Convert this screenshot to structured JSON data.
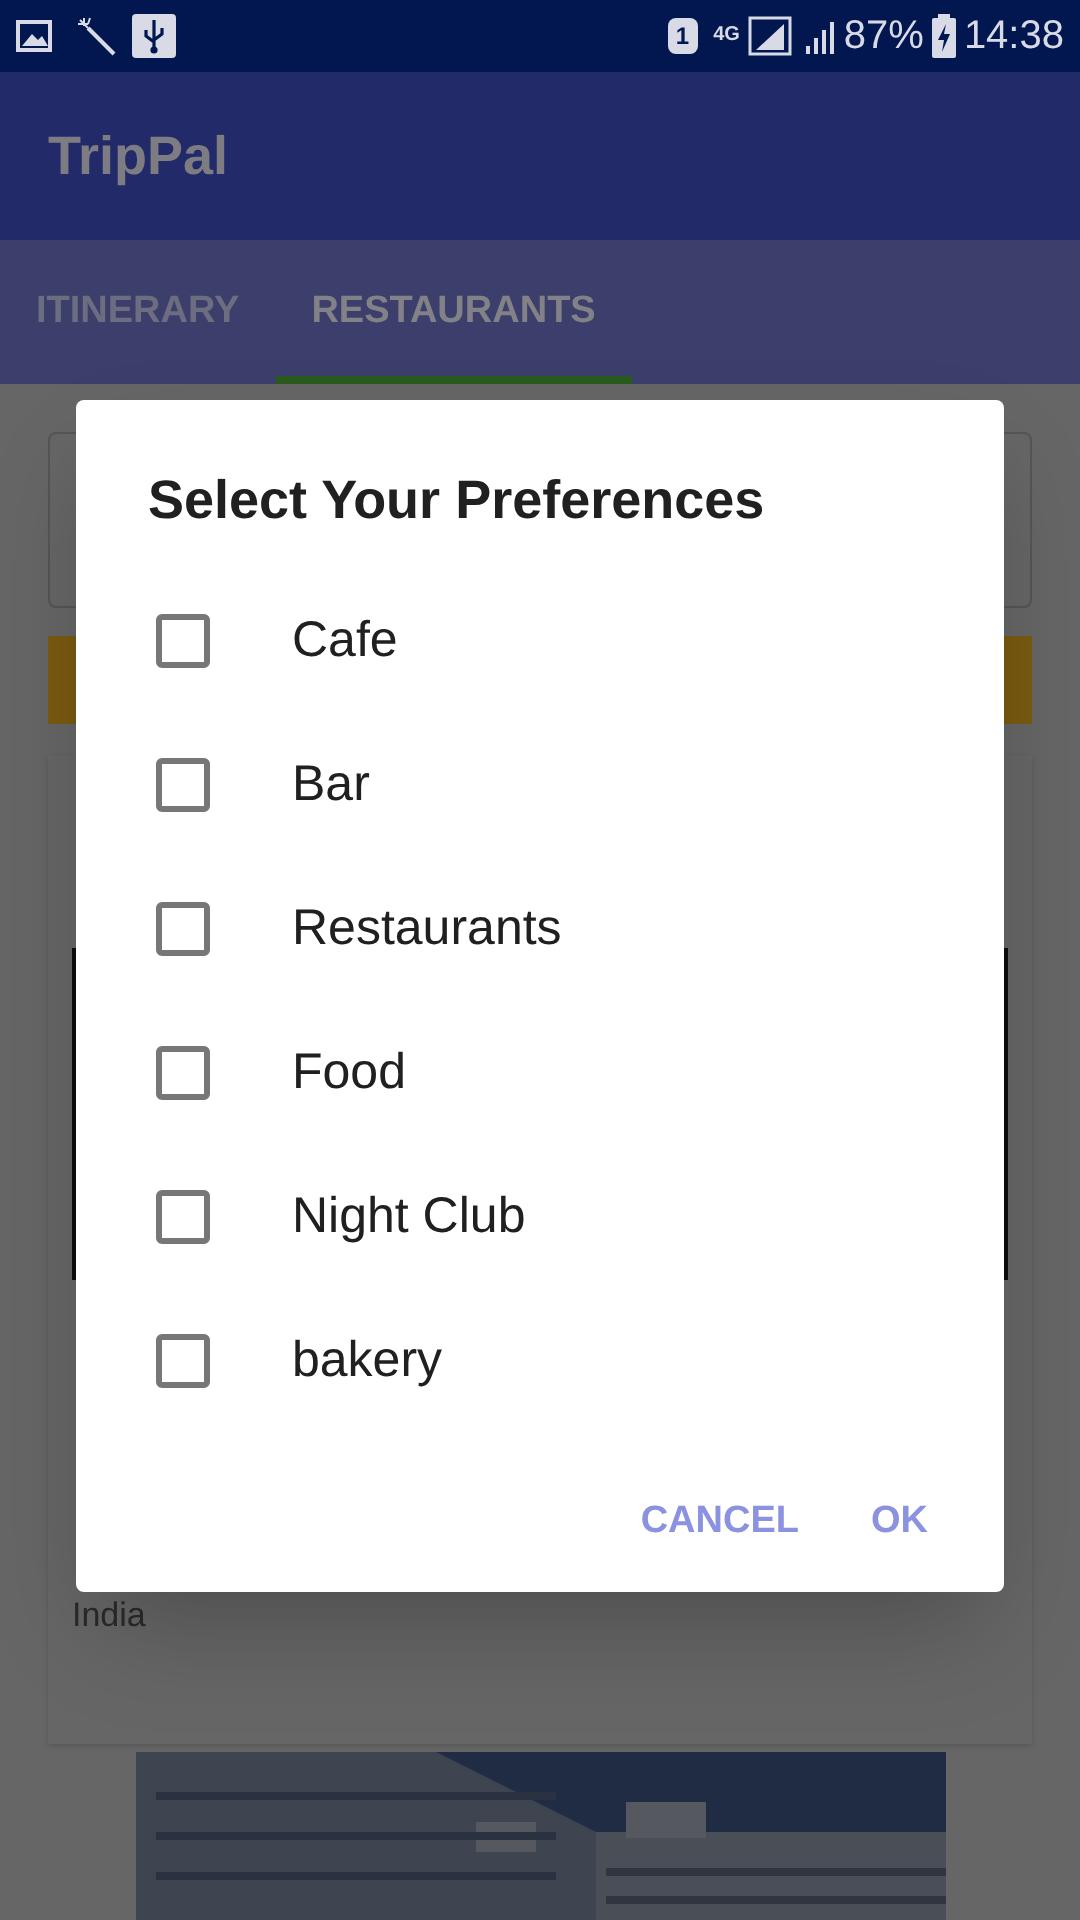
{
  "status_bar": {
    "sim": "1",
    "network": "4G",
    "battery": "87%",
    "time": "14:38"
  },
  "app_bar": {
    "title": "TripPal"
  },
  "tabs": [
    {
      "label": "ITINERARY",
      "selected": false
    },
    {
      "label": "RESTAURANTS",
      "selected": true
    }
  ],
  "background": {
    "card_text": "India"
  },
  "dialog": {
    "title": "Select Your Preferences",
    "options": [
      {
        "label": "Cafe",
        "checked": false
      },
      {
        "label": "Bar",
        "checked": false
      },
      {
        "label": "Restaurants",
        "checked": false
      },
      {
        "label": "Food",
        "checked": false
      },
      {
        "label": "Night Club",
        "checked": false
      },
      {
        "label": "bakery",
        "checked": false
      }
    ],
    "buttons": [
      "CANCEL",
      "OK"
    ]
  }
}
